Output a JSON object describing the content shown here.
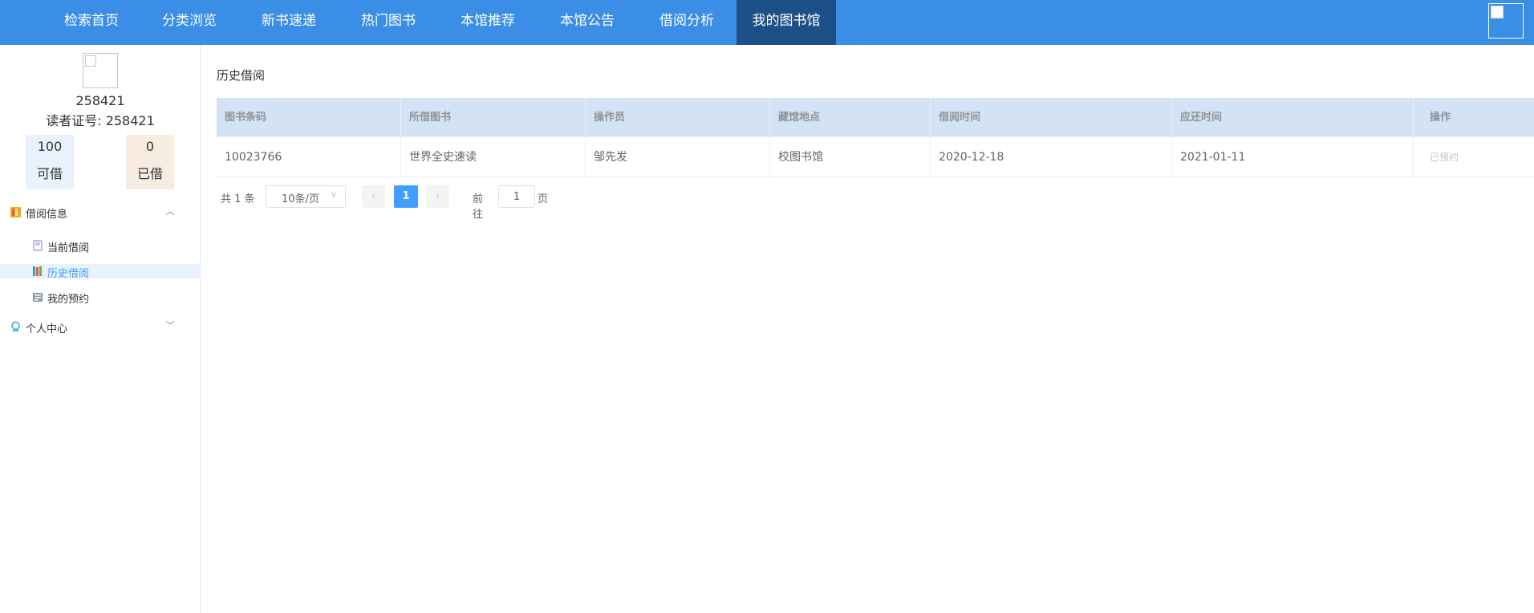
{
  "nav": {
    "items": [
      "检索首页",
      "分类浏览",
      "新书速递",
      "热门图书",
      "本馆推荐",
      "本馆公告",
      "借阅分析",
      "我的图书馆"
    ],
    "active_index": 7
  },
  "profile": {
    "name": "258421",
    "card_label": "读者证号: 258421",
    "available_count": "100",
    "available_label": "可借",
    "borrowed_count": "0",
    "borrowed_label": "已借"
  },
  "sidebar": {
    "group1": {
      "label": "借阅信息",
      "icon": "books-icon",
      "chevron": "chevron-up-icon"
    },
    "items": [
      {
        "label": "当前借阅",
        "icon": "book-icon"
      },
      {
        "label": "历史借阅",
        "icon": "library-icon"
      },
      {
        "label": "我的预约",
        "icon": "reserve-icon"
      }
    ],
    "active_item": 1,
    "group2": {
      "label": "个人中心",
      "icon": "medal-icon",
      "chevron": "chevron-down-icon"
    }
  },
  "main": {
    "title": "历史借阅",
    "table": {
      "headers": [
        "图书条码",
        "所借图书",
        "操作员",
        "藏馆地点",
        "借阅时间",
        "应还时间",
        "操作"
      ],
      "rows": [
        [
          "10023766",
          "世界全史速读",
          "邹先发",
          "校图书馆",
          "2020-12-18",
          "2021-01-11",
          "已预约"
        ]
      ]
    },
    "pagination": {
      "total": "共 1 条",
      "page_size": "10条/页",
      "current_page": "1",
      "goto_label": "前往",
      "goto_value": "1",
      "page_suffix": "页"
    }
  },
  "colors": {
    "nav_bg": "#3a8ee6",
    "nav_active": "#1d5089",
    "accent": "#409eff",
    "header_bg": "#d3e3f3"
  }
}
